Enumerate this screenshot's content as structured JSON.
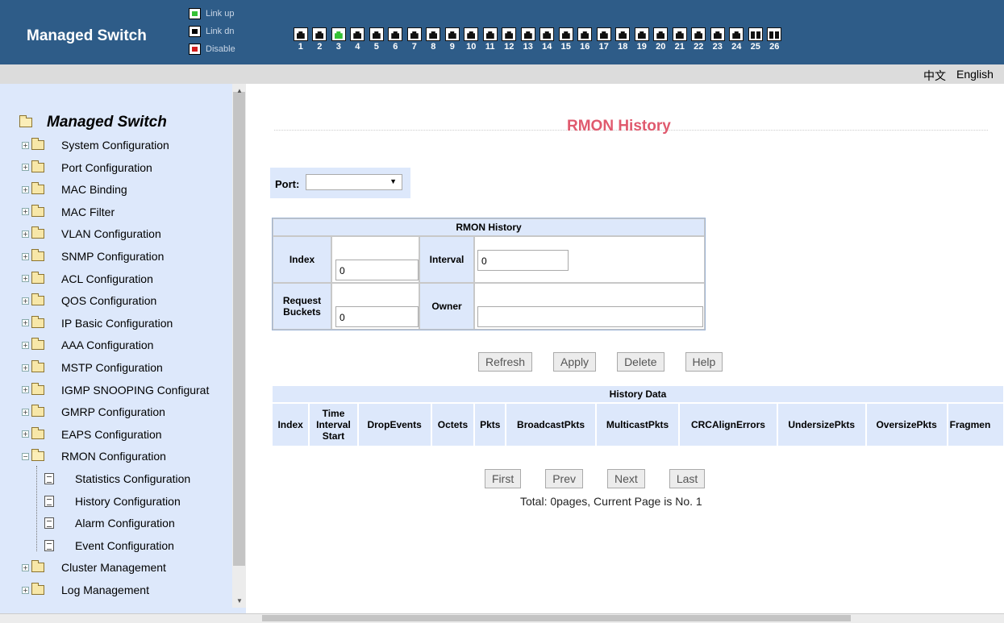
{
  "header": {
    "brand": "Managed Switch",
    "legend": [
      {
        "label": "Link up",
        "state": "up"
      },
      {
        "label": "Link dn",
        "state": "down"
      },
      {
        "label": "Disable",
        "state": "disabled"
      }
    ],
    "ports": [
      {
        "num": "1",
        "state": "down",
        "kind": "copper"
      },
      {
        "num": "2",
        "state": "down",
        "kind": "copper"
      },
      {
        "num": "3",
        "state": "up",
        "kind": "copper"
      },
      {
        "num": "4",
        "state": "down",
        "kind": "copper"
      },
      {
        "num": "5",
        "state": "down",
        "kind": "copper"
      },
      {
        "num": "6",
        "state": "down",
        "kind": "copper"
      },
      {
        "num": "7",
        "state": "down",
        "kind": "copper"
      },
      {
        "num": "8",
        "state": "down",
        "kind": "copper"
      },
      {
        "num": "9",
        "state": "down",
        "kind": "copper"
      },
      {
        "num": "10",
        "state": "down",
        "kind": "copper"
      },
      {
        "num": "11",
        "state": "down",
        "kind": "copper"
      },
      {
        "num": "12",
        "state": "down",
        "kind": "copper"
      },
      {
        "num": "13",
        "state": "down",
        "kind": "copper"
      },
      {
        "num": "14",
        "state": "down",
        "kind": "copper"
      },
      {
        "num": "15",
        "state": "down",
        "kind": "copper"
      },
      {
        "num": "16",
        "state": "down",
        "kind": "copper"
      },
      {
        "num": "17",
        "state": "down",
        "kind": "copper"
      },
      {
        "num": "18",
        "state": "down",
        "kind": "copper"
      },
      {
        "num": "19",
        "state": "down",
        "kind": "copper"
      },
      {
        "num": "20",
        "state": "down",
        "kind": "copper"
      },
      {
        "num": "21",
        "state": "down",
        "kind": "copper"
      },
      {
        "num": "22",
        "state": "down",
        "kind": "copper"
      },
      {
        "num": "23",
        "state": "down",
        "kind": "copper"
      },
      {
        "num": "24",
        "state": "down",
        "kind": "copper"
      },
      {
        "num": "25",
        "state": "down",
        "kind": "fiber"
      },
      {
        "num": "26",
        "state": "down",
        "kind": "fiber"
      }
    ]
  },
  "language": {
    "zh": "中文",
    "en": "English"
  },
  "sidebar": {
    "root": "Managed Switch",
    "items": [
      {
        "label": "System Configuration",
        "icon": "folder-icon"
      },
      {
        "label": "Port Configuration",
        "icon": "folder-icon"
      },
      {
        "label": "MAC Binding",
        "icon": "folder-icon"
      },
      {
        "label": "MAC Filter",
        "icon": "folder-icon"
      },
      {
        "label": "VLAN Configuration",
        "icon": "folder-icon"
      },
      {
        "label": "SNMP Configuration",
        "icon": "folder-icon"
      },
      {
        "label": "ACL Configuration",
        "icon": "folder-icon"
      },
      {
        "label": "QOS Configuration",
        "icon": "folder-icon"
      },
      {
        "label": "IP Basic Configuration",
        "icon": "folder-icon"
      },
      {
        "label": "AAA Configuration",
        "icon": "folder-icon"
      },
      {
        "label": "MSTP Configuration",
        "icon": "folder-icon"
      },
      {
        "label": "IGMP SNOOPING Configurat",
        "icon": "folder-icon"
      },
      {
        "label": "GMRP Configuration",
        "icon": "folder-icon"
      },
      {
        "label": "EAPS Configuration",
        "icon": "folder-icon"
      },
      {
        "label": "RMON Configuration",
        "icon": "folder-open-icon"
      }
    ],
    "children": [
      {
        "label": "Statistics Configuration",
        "icon": "document-icon"
      },
      {
        "label": "History Configuration",
        "icon": "document-icon"
      },
      {
        "label": "Alarm Configuration",
        "icon": "document-icon"
      },
      {
        "label": "Event Configuration",
        "icon": "document-icon"
      }
    ],
    "after": [
      {
        "label": "Cluster Management",
        "icon": "folder-icon"
      },
      {
        "label": "Log Management",
        "icon": "folder-icon"
      }
    ]
  },
  "main": {
    "title": "RMON History",
    "port_label": "Port:",
    "port_value": "",
    "form": {
      "title": "RMON History",
      "index_label": "Index",
      "index_value": "0",
      "interval_label": "Interval",
      "interval_value": "0",
      "request_label_1": "Request",
      "request_label_2": "Buckets",
      "request_value": "0",
      "owner_label": "Owner",
      "owner_value": ""
    },
    "buttons": {
      "refresh": "Refresh",
      "apply": "Apply",
      "delete": "Delete",
      "help": "Help"
    },
    "history": {
      "title": "History Data",
      "col_index": "Index",
      "col_time_1": "Time",
      "col_time_2": "Interval",
      "col_time_3": "Start",
      "col_drop": "DropEvents",
      "col_octets": "Octets",
      "col_pkts": "Pkts",
      "col_bcast": "BroadcastPkts",
      "col_mcast": "MulticastPkts",
      "col_crc": "CRCAlignErrors",
      "col_under": "UndersizePkts",
      "col_over": "OversizePkts",
      "col_frag": "Fragmen"
    },
    "pager": {
      "first": "First",
      "prev": "Prev",
      "next": "Next",
      "last": "Last"
    },
    "total": "Total: 0pages, Current Page is No. 1"
  }
}
